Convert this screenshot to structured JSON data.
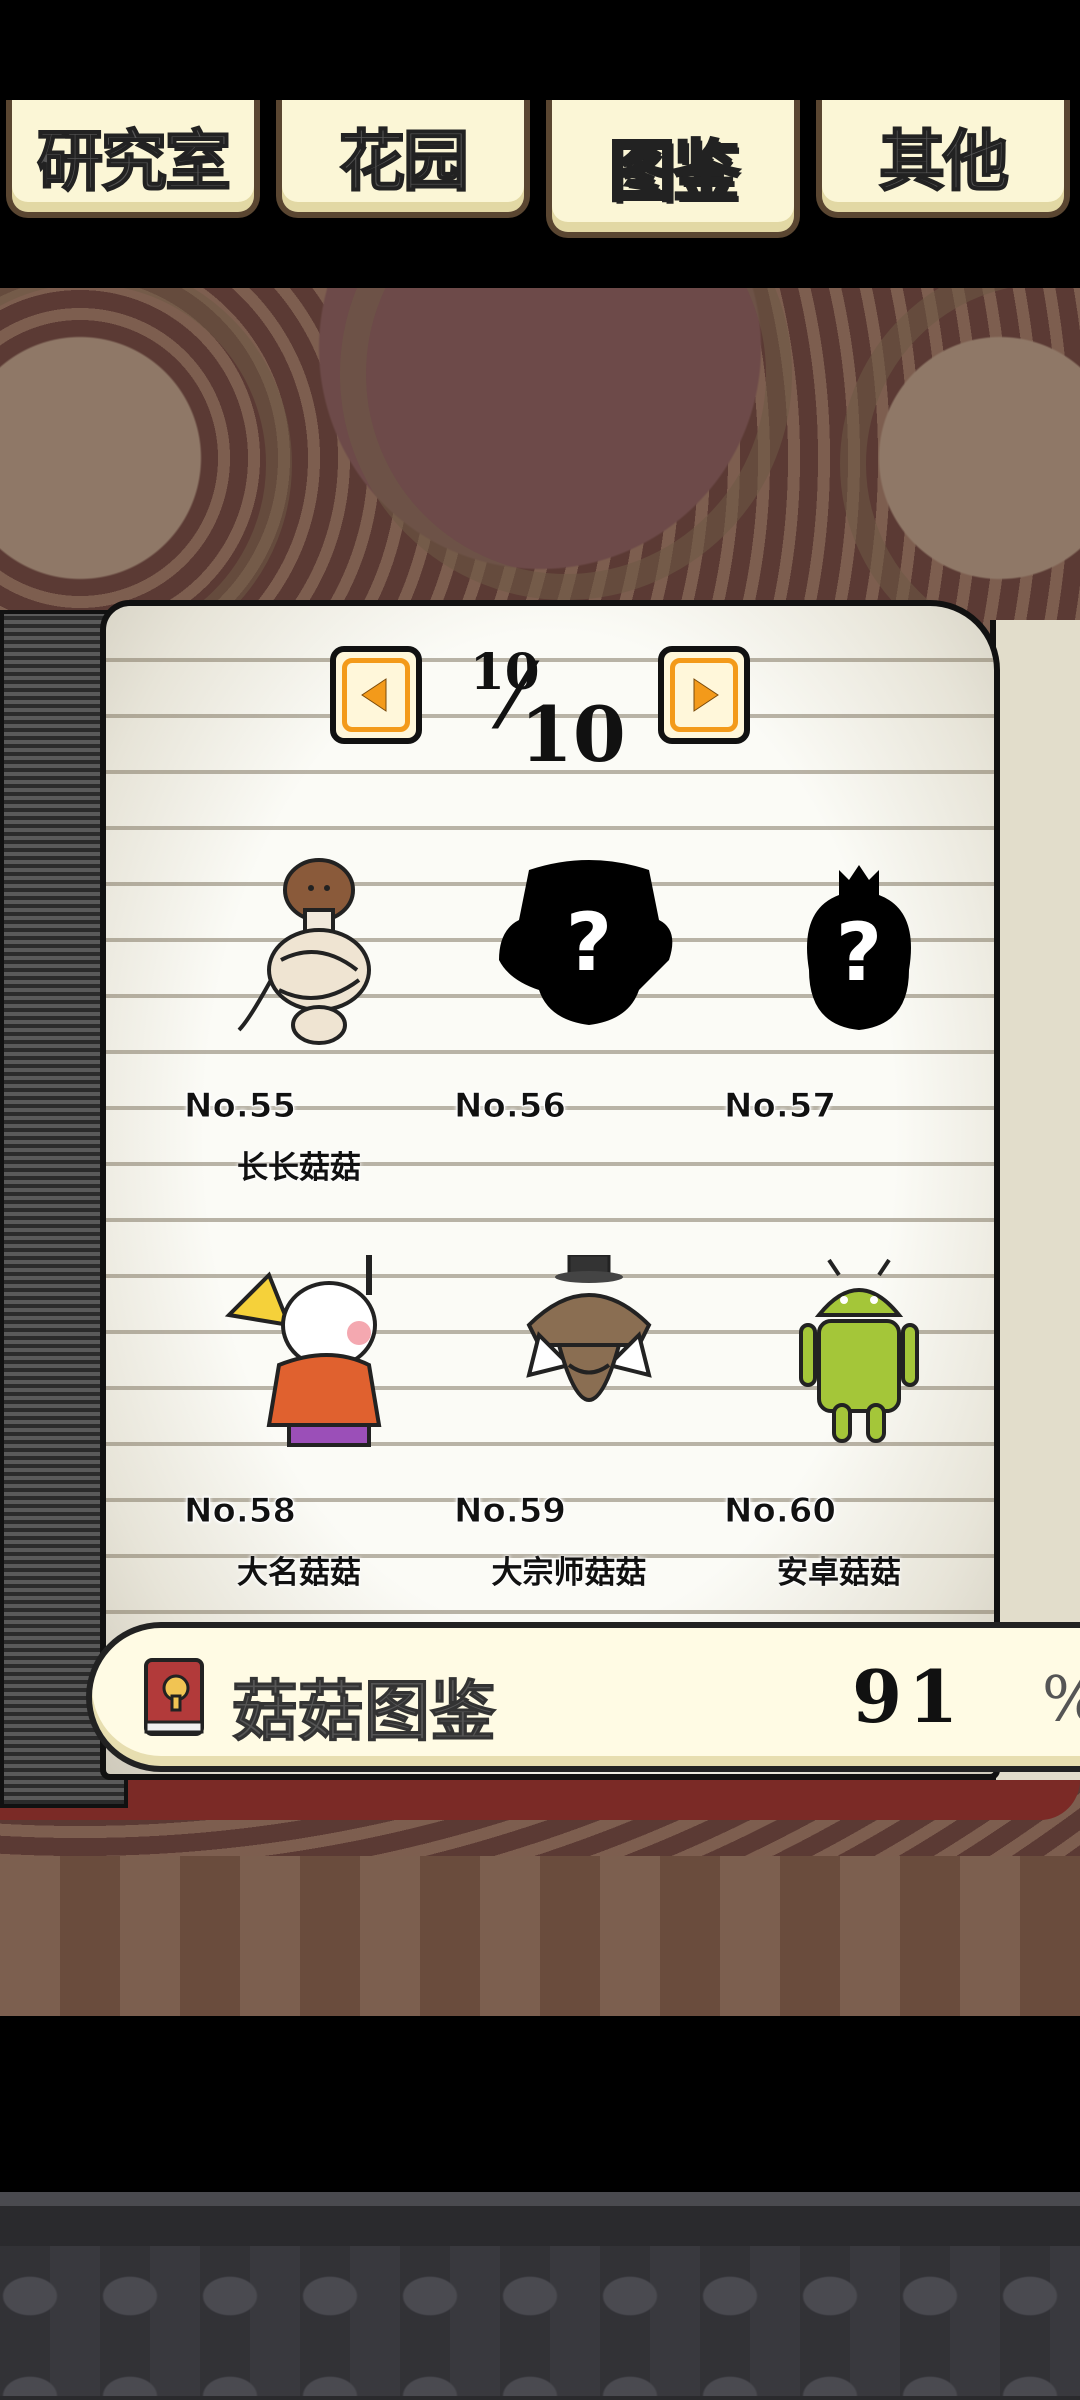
{
  "tabs": [
    {
      "label": "研究室",
      "active": false
    },
    {
      "label": "花园",
      "active": false
    },
    {
      "label": "图鉴",
      "active": true
    },
    {
      "label": "其他",
      "active": false
    }
  ],
  "pager": {
    "current": "10",
    "total": "10",
    "prev_icon": "left-arrow-icon",
    "next_icon": "right-arrow-icon"
  },
  "entries": [
    {
      "number": "No.55",
      "name": "长长菇菇",
      "unlocked": true
    },
    {
      "number": "No.56",
      "name": "",
      "unlocked": false
    },
    {
      "number": "No.57",
      "name": "",
      "unlocked": false
    },
    {
      "number": "No.58",
      "name": "大名菇菇",
      "unlocked": true
    },
    {
      "number": "No.59",
      "name": "大宗师菇菇",
      "unlocked": true
    },
    {
      "number": "No.60",
      "name": "安卓菇菇",
      "unlocked": true
    }
  ],
  "collection": {
    "label": "菇菇图鉴",
    "percent": "91",
    "percent_sign": "%",
    "icon": "book-icon"
  },
  "colors": {
    "accent_orange": "#f39a1a",
    "active_tab_text": "#f4e428",
    "book_cover": "#7b2a26"
  }
}
